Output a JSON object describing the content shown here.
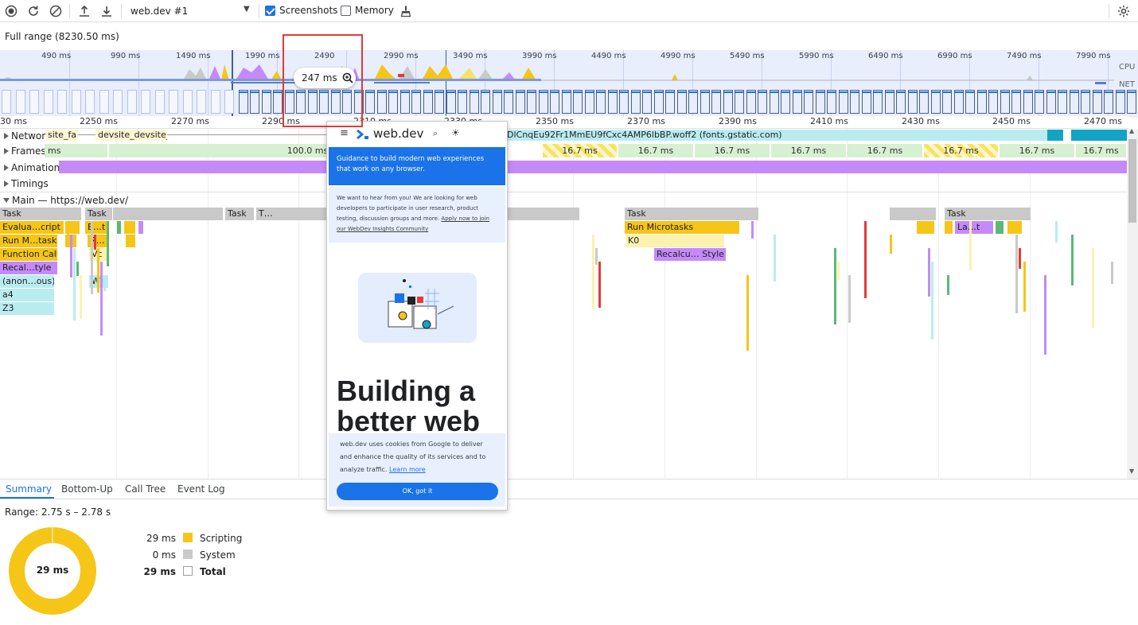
{
  "toolbar": {
    "profile_select": "web.dev #1",
    "screenshots_label": "Screenshots",
    "memory_label": "Memory"
  },
  "overview": {
    "range_label": "Full range (8230.50 ms)",
    "ticks": [
      "490 ms",
      "990 ms",
      "1490 ms",
      "1990 ms",
      "2490",
      "2990 ms",
      "3490 ms",
      "3990 ms",
      "4490 ms",
      "4990 ms",
      "5490 ms",
      "5990 ms",
      "6490 ms",
      "6990 ms",
      "7490 ms",
      "7990 ms"
    ],
    "cpu_label": "CPU",
    "net_label": "NET",
    "selection_duration": "247 ms"
  },
  "timeline": {
    "ticks": [
      "30 ms",
      "2250 ms",
      "2270 ms",
      "2290 ms",
      "2310 ms",
      "2330 ms",
      "2350 ms",
      "2370 ms",
      "2390 ms",
      "2410 ms",
      "2430 ms",
      "2450 ms",
      "2470 ms"
    ],
    "tracks": {
      "network": "Network",
      "frames": "Frames",
      "animations": "Animations",
      "timings": "Timings",
      "main": "Main — https://web.dev/"
    },
    "network_items": [
      "site_fa",
      "devsite_devsite_m",
      "DlCnqEu92Fr1MmEU9fCxc4AMP6lbBP.woff2 (fonts.gstatic.com)"
    ],
    "frames": {
      "first": "ms",
      "long": "100.0 ms",
      "short": "16.7 ms"
    },
    "main_events": {
      "task": "Task",
      "task_t": "T…",
      "eval_script": "Evalua…cript",
      "eval_short": "E…t",
      "run_microtasks_short": "Run M…tasks",
      "r_short": "R…",
      "function_call": "Function Call",
      "vc": "Vc",
      "recalc_style_short": "Recal…tyle",
      "anonymous": "(anon…ous)",
      "wl": "Wl",
      "a4": "a4",
      "z3": "Z3",
      "run_microtasks": "Run Microtasks",
      "k0": "K0",
      "recalc_style": "Recalcu… Style",
      "layout_short": "La…t"
    }
  },
  "screenshot_popup": {
    "site_name": "web.dev",
    "banner": "Guidance to build modern web experiences that work on any browser.",
    "survey_text": "We want to hear from you! We are looking for web developers to participate in user research, product testing, discussion groups and more.",
    "survey_link": "Apply now to join our WebDev Insights Community",
    "headline": "Building a better web",
    "cookie_text": "web.dev uses cookies from Google to deliver and enhance the quality of its services and to analyze traffic.",
    "cookie_link": "Learn more",
    "cookie_button": "OK, got it"
  },
  "bottom_panel": {
    "tabs": [
      "Summary",
      "Bottom-Up",
      "Call Tree",
      "Event Log"
    ],
    "range": "Range: 2.75 s – 2.78 s",
    "donut_total": "29 ms",
    "rows": [
      {
        "value": "29 ms",
        "label": "Scripting",
        "color": "#f5c518"
      },
      {
        "value": "0 ms",
        "label": "System",
        "color": "#c9c9c9"
      },
      {
        "value": "29 ms",
        "label": "Total",
        "color": "#ffffff"
      }
    ]
  },
  "colors": {
    "accent": "#1a73e8",
    "scripting": "#f5c518",
    "rendering": "#c58af9",
    "painting": "#5bb974",
    "selection": "#e53935"
  }
}
